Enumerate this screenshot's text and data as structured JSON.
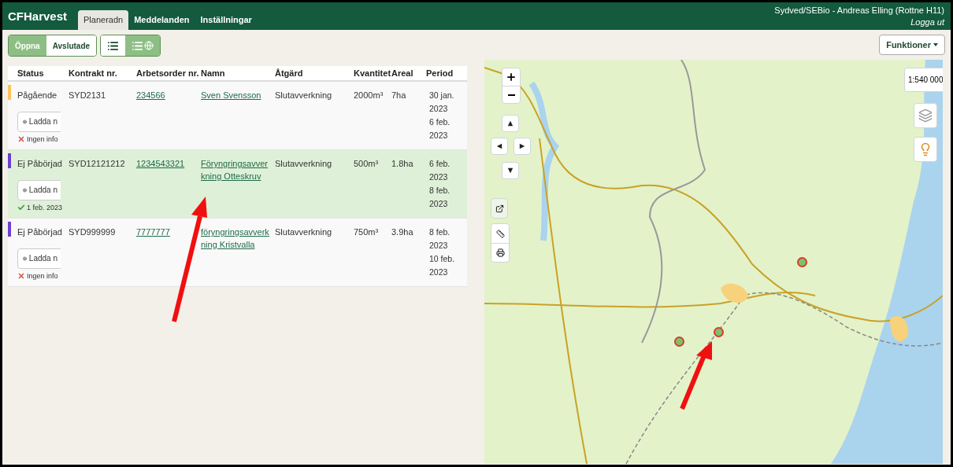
{
  "header": {
    "brand": "CFHarvest",
    "tabs": [
      {
        "label": "Planeradn",
        "selected": true
      },
      {
        "label": "Meddelanden",
        "selected": false
      },
      {
        "label": "Inställningar",
        "selected": false
      }
    ],
    "user": "Sydved/SEBio - Andreas Elling (Rottne H11)",
    "logout": "Logga ut"
  },
  "filters": [
    {
      "label": "Öppna",
      "selected": true
    },
    {
      "label": "Avslutade",
      "selected": false
    }
  ],
  "views": [
    {
      "kind": "list",
      "selected": false
    },
    {
      "kind": "list-map",
      "selected": true
    }
  ],
  "functions_button": "Funktioner",
  "table": {
    "columns": [
      "Status",
      "Kontrakt nr.",
      "Arbetsorder nr.",
      "Namn",
      "Åtgärd",
      "Kvantitet",
      "Areal",
      "Period"
    ],
    "rows": [
      {
        "status": "Pågående",
        "color": "#fdc35b",
        "selected": false,
        "contract": "SYD2131",
        "order": "234566",
        "name": "Sven Svensson",
        "action": "Slutavverkning",
        "quantity": "2000m³",
        "area": "7ha",
        "period": [
          "30 jan.",
          "2023",
          "6 feb.",
          "2023"
        ],
        "download": "Ladda n",
        "info": {
          "kind": "missing",
          "text": "Ingen info"
        }
      },
      {
        "status": "Ej Påbörjad",
        "color": "#6c3fd1",
        "selected": true,
        "contract": "SYD12121212",
        "order": "1234543321",
        "name": "Föryngringsavverkning Otteskruv",
        "action": "Slutavverkning",
        "quantity": "500m³",
        "area": "1.8ha",
        "period": [
          "6 feb.",
          "2023",
          "8 feb.",
          "2023"
        ],
        "download": "Ladda n",
        "info": {
          "kind": "done",
          "text": "1 feb. 2023"
        }
      },
      {
        "status": "Ej Påbörjad",
        "color": "#6c3fd1",
        "selected": false,
        "contract": "SYD999999",
        "order": "7777777",
        "name": "föryngringsavverkning Kristvalla",
        "action": "Slutavverkning",
        "quantity": "750m³",
        "area": "3.9ha",
        "period": [
          "8 feb.",
          "2023",
          "10 feb.",
          "2023"
        ],
        "download": "Ladda n",
        "info": {
          "kind": "missing",
          "text": "Ingen info"
        }
      }
    ]
  },
  "map": {
    "scale": "1:540 000"
  }
}
